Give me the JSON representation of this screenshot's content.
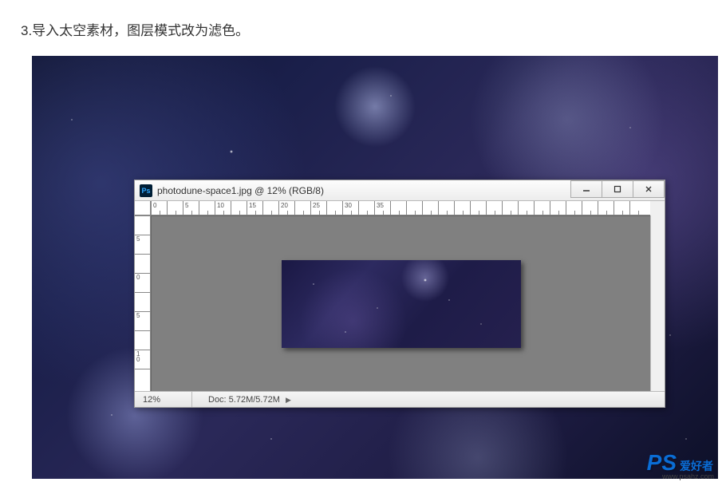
{
  "caption": "3.导入太空素材，图层模式改为滤色。",
  "window": {
    "title": "photodune-space1.jpg @ 12% (RGB/8)",
    "icon_label": "Ps"
  },
  "rulers": {
    "horizontal": [
      "0",
      "",
      "5",
      "",
      "10",
      "",
      "15",
      "",
      "20",
      "",
      "25",
      "",
      "30",
      "",
      "35"
    ],
    "vertical": [
      "",
      "5",
      "",
      "0",
      "",
      "5",
      "",
      "10",
      ""
    ]
  },
  "status": {
    "zoom": "12%",
    "doc": "Doc: 5.72M/5.72M"
  },
  "watermark": {
    "logo": "PS",
    "text": "爱好者",
    "url": "www.psahz.com"
  }
}
